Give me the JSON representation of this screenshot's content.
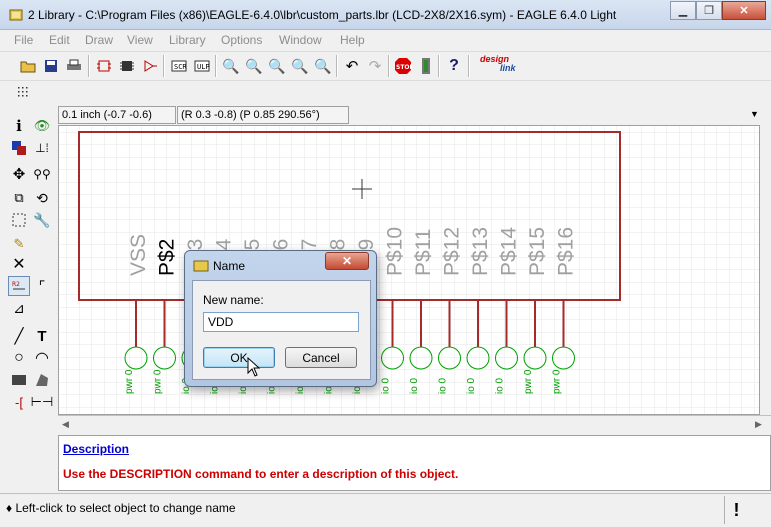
{
  "window": {
    "title": "2 Library - C:\\Program Files (x86)\\EAGLE-6.4.0\\lbr\\custom_parts.lbr (LCD-2X8/2X16.sym) - EAGLE 6.4.0 Light",
    "minimize_icon": "minimize-icon",
    "maximize_icon": "maximize-icon",
    "close_icon": "close-icon"
  },
  "menu": {
    "items": [
      "File",
      "Edit",
      "Draw",
      "View",
      "Library",
      "Options",
      "Window",
      "Help"
    ]
  },
  "toolbar": {
    "designlink_top": "design",
    "designlink_bottom": "link"
  },
  "coords": {
    "grid": "0.1 inch (-0.7 -0.6)",
    "polar": "(R 0.3 -0.8) (P 0.85 290.56°)"
  },
  "canvas": {
    "top_labels": [
      "VSS",
      "P$2",
      "P$3",
      "P$4",
      "P$5",
      "P$6",
      "P$7",
      "P$8",
      "P$9",
      "P$10",
      "P$11",
      "P$12",
      "P$13",
      "P$14",
      "P$15",
      "P$16"
    ],
    "pin_labels": [
      "pwr 0",
      "pwr 0",
      "io 0",
      "io 0",
      "io 0",
      "io 0",
      "io 0",
      "io 0",
      "io 0",
      "io 0",
      "io 0",
      "io 0",
      "io 0",
      "io 0",
      "pwr 0",
      "pwr 0"
    ]
  },
  "description": {
    "link": "Description",
    "text": "Use the DESCRIPTION command to enter a description of this object."
  },
  "status": {
    "text": "♦ Left-click to select object to change name",
    "bang": "!"
  },
  "dialog": {
    "title": "Name",
    "close_label": "✕",
    "label": "New name:",
    "value": "VDD",
    "ok_label": "OK",
    "cancel_label": "Cancel"
  },
  "colors": {
    "outline": "#a52a2a",
    "pin": "#a52a2a",
    "label_gray": "#a0a0a0",
    "pin_green": "#00a000",
    "desc_link": "#0000d0",
    "desc_text": "#cc0000"
  }
}
